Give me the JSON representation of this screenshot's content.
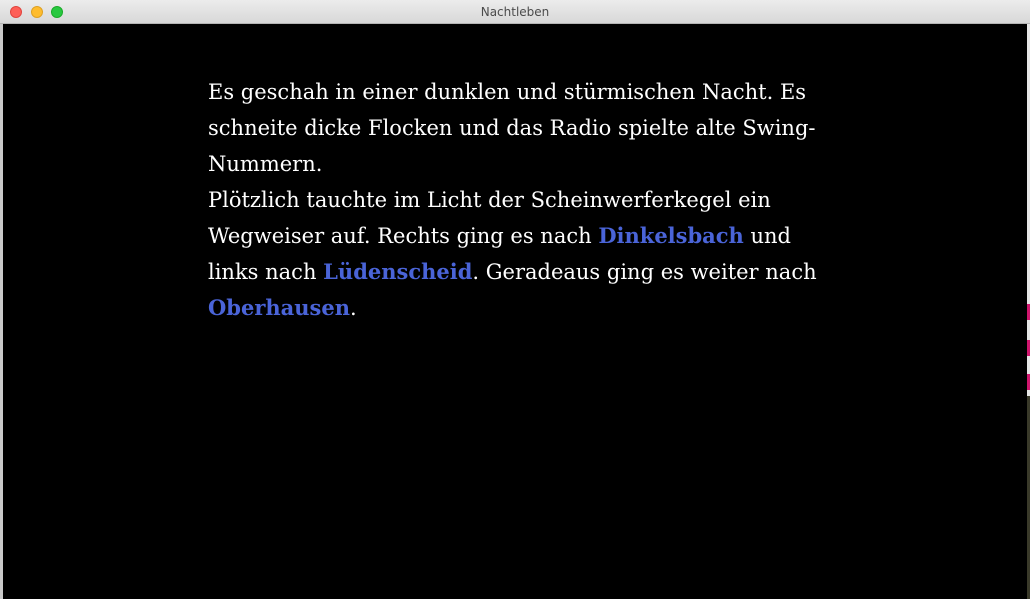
{
  "window": {
    "title": "Nachtleben"
  },
  "story": {
    "paragraph1": "Es geschah in einer dunklen und stürmischen Nacht. Es schneite dicke Flocken und das Radio spielte alte Swing-Nummern.",
    "p2_part1": "Plötzlich tauchte im Licht der Scheinwerferkegel ein Wegweiser auf. Rechts ging es nach ",
    "link_dinkelsbach": "Dinkelsbach",
    "p2_part2": " und links nach ",
    "link_luedenscheid": "Lüdenscheid",
    "p2_part3": ". Geradeaus ging es weiter nach ",
    "link_oberhausen": "Oberhausen",
    "p2_part4": "."
  },
  "colors": {
    "background": "#000000",
    "text": "#ffffff",
    "link": "#4a64d8"
  }
}
